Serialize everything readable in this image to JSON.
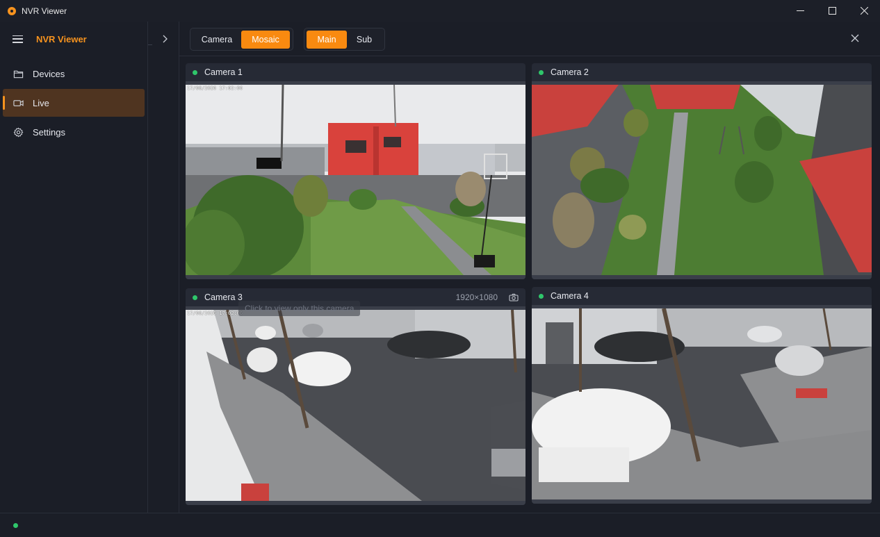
{
  "window": {
    "title": "NVR Viewer"
  },
  "sidebar": {
    "brand": "NVR Viewer",
    "items": [
      {
        "label": "Devices",
        "icon": "folder-icon",
        "active": false
      },
      {
        "label": "Live",
        "icon": "video-icon",
        "active": true
      },
      {
        "label": "Settings",
        "icon": "gear-icon",
        "active": false
      }
    ]
  },
  "toolbar": {
    "view_mode": {
      "options": [
        "Camera",
        "Mosaic"
      ],
      "selected": "Mosaic"
    },
    "stream": {
      "options": [
        "Main",
        "Sub"
      ],
      "selected": "Main"
    }
  },
  "cameras": [
    {
      "name": "Camera 1",
      "status": "online",
      "timestamp": "17/08/2026 17:02:06"
    },
    {
      "name": "Camera 2",
      "status": "online"
    },
    {
      "name": "Camera 3",
      "status": "online",
      "resolution": "1920×1080",
      "timestamp": "17/08/2026 17:02:06"
    },
    {
      "name": "Camera 4",
      "status": "online"
    }
  ],
  "tooltip": "Click to view only this camera",
  "colors": {
    "accent": "#f98a10",
    "online": "#2fc76b",
    "bg": "#1b1e27",
    "panel": "#262a35"
  }
}
